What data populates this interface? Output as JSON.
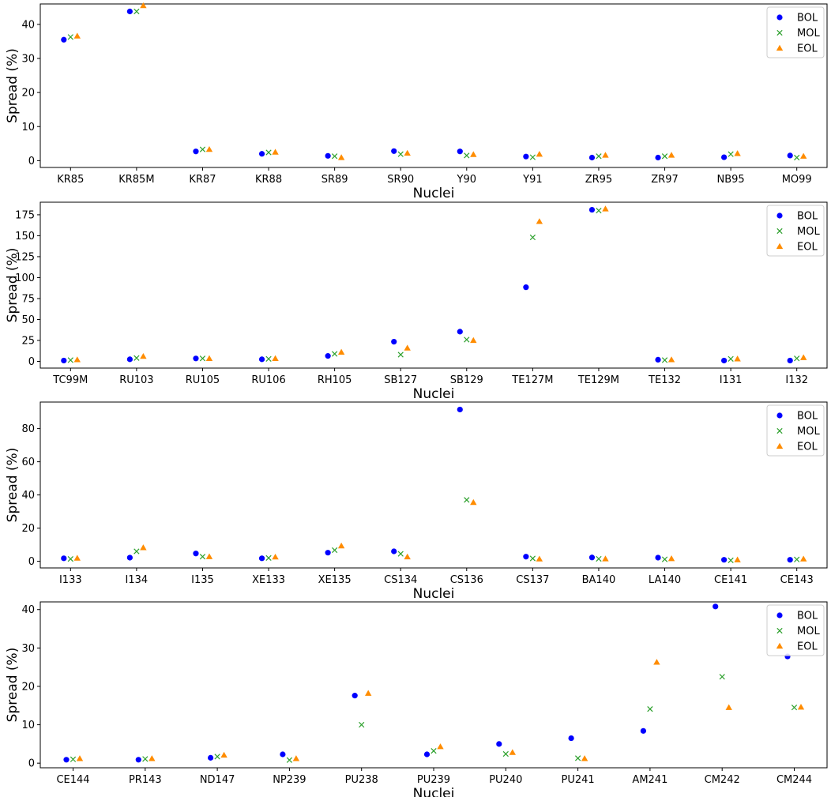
{
  "chart_data": [
    {
      "type": "scatter",
      "xlabel": "Nuclei",
      "ylabel": "Spread (%)",
      "ylim": [
        -2,
        46
      ],
      "yticks": [
        0,
        10,
        20,
        30,
        40
      ],
      "legend_position": "top-right",
      "categories": [
        "KR85",
        "KR85M",
        "KR87",
        "KR88",
        "SR89",
        "SR90",
        "Y90",
        "Y91",
        "ZR95",
        "ZR97",
        "NB95",
        "MO99"
      ],
      "series": [
        {
          "name": "BOL",
          "marker": "circle",
          "color": "#0000ff",
          "values": [
            35.5,
            43.8,
            2.7,
            2.0,
            1.4,
            2.8,
            2.7,
            1.2,
            0.9,
            0.9,
            1.0,
            1.5
          ]
        },
        {
          "name": "MOL",
          "marker": "x",
          "color": "#2ca02c",
          "values": [
            36.3,
            43.8,
            3.3,
            2.4,
            1.3,
            1.9,
            1.5,
            1.0,
            1.3,
            1.3,
            1.9,
            0.9
          ]
        },
        {
          "name": "EOL",
          "marker": "triangle",
          "color": "#ff8c00",
          "values": [
            36.6,
            45.5,
            3.3,
            2.5,
            0.9,
            2.2,
            1.8,
            1.9,
            1.6,
            1.6,
            2.1,
            1.3
          ]
        }
      ]
    },
    {
      "type": "scatter",
      "xlabel": "Nuclei",
      "ylabel": "Spread (%)",
      "ylim": [
        -8,
        190
      ],
      "yticks": [
        0,
        25,
        50,
        75,
        100,
        125,
        150,
        175
      ],
      "legend_position": "top-right",
      "categories": [
        "TC99M",
        "RU103",
        "RU105",
        "RU106",
        "RH105",
        "SB127",
        "SB129",
        "TE127M",
        "TE129M",
        "TE132",
        "I131",
        "I132"
      ],
      "series": [
        {
          "name": "BOL",
          "marker": "circle",
          "color": "#0000ff",
          "values": [
            1,
            2.5,
            3.5,
            2.5,
            6.5,
            23.5,
            35.5,
            88.5,
            181,
            2,
            1,
            1
          ]
        },
        {
          "name": "MOL",
          "marker": "x",
          "color": "#2ca02c",
          "values": [
            1.5,
            4,
            3.5,
            3,
            9,
            8,
            26,
            148,
            180,
            1.5,
            3,
            3.5
          ]
        },
        {
          "name": "EOL",
          "marker": "triangle",
          "color": "#ff8c00",
          "values": [
            2,
            6,
            3.5,
            3.5,
            11,
            16,
            25,
            167,
            182,
            2,
            3,
            4.5
          ]
        }
      ]
    },
    {
      "type": "scatter",
      "xlabel": "Nuclei",
      "ylabel": "Spread (%)",
      "ylim": [
        -4,
        96
      ],
      "yticks": [
        0,
        20,
        40,
        60,
        80
      ],
      "legend_position": "top-right",
      "categories": [
        "I133",
        "I134",
        "I135",
        "XE133",
        "XE135",
        "CS134",
        "CS136",
        "CS137",
        "BA140",
        "LA140",
        "CE141",
        "CE143"
      ],
      "series": [
        {
          "name": "BOL",
          "marker": "circle",
          "color": "#0000ff",
          "values": [
            1.8,
            2.2,
            4.7,
            1.8,
            5.2,
            6,
            91.5,
            2.8,
            2.3,
            2.2,
            0.9,
            0.9
          ]
        },
        {
          "name": "MOL",
          "marker": "x",
          "color": "#2ca02c",
          "values": [
            1.4,
            6,
            2.8,
            2,
            6.7,
            4.5,
            37,
            1.7,
            1.5,
            1.2,
            0.6,
            1.1
          ]
        },
        {
          "name": "EOL",
          "marker": "triangle",
          "color": "#ff8c00",
          "values": [
            1.9,
            8.2,
            2.8,
            2.6,
            9.3,
            2.7,
            35.5,
            1.4,
            1.5,
            1.6,
            0.9,
            1.4
          ]
        }
      ]
    },
    {
      "type": "scatter",
      "xlabel": "Nuclei",
      "ylabel": "Spread (%)",
      "ylim": [
        -1.2,
        42
      ],
      "yticks": [
        0,
        10,
        20,
        30,
        40
      ],
      "legend_position": "top-right",
      "categories": [
        "CE144",
        "PR143",
        "ND147",
        "NP239",
        "PU238",
        "PU239",
        "PU240",
        "PU241",
        "AM241",
        "CM242",
        "CM244"
      ],
      "series": [
        {
          "name": "BOL",
          "marker": "circle",
          "color": "#0000ff",
          "values": [
            0.9,
            0.9,
            1.4,
            2.3,
            17.6,
            2.3,
            5,
            6.5,
            8.4,
            40.8,
            27.8
          ]
        },
        {
          "name": "MOL",
          "marker": "x",
          "color": "#2ca02c",
          "values": [
            1,
            1.1,
            1.7,
            0.8,
            10,
            3.2,
            2.4,
            1.3,
            14.1,
            22.5,
            14.5
          ]
        },
        {
          "name": "EOL",
          "marker": "triangle",
          "color": "#ff8c00",
          "values": [
            1.2,
            1.2,
            2.1,
            1.2,
            18.2,
            4.3,
            2.8,
            1.2,
            26.3,
            14.5,
            14.6
          ]
        }
      ]
    }
  ]
}
